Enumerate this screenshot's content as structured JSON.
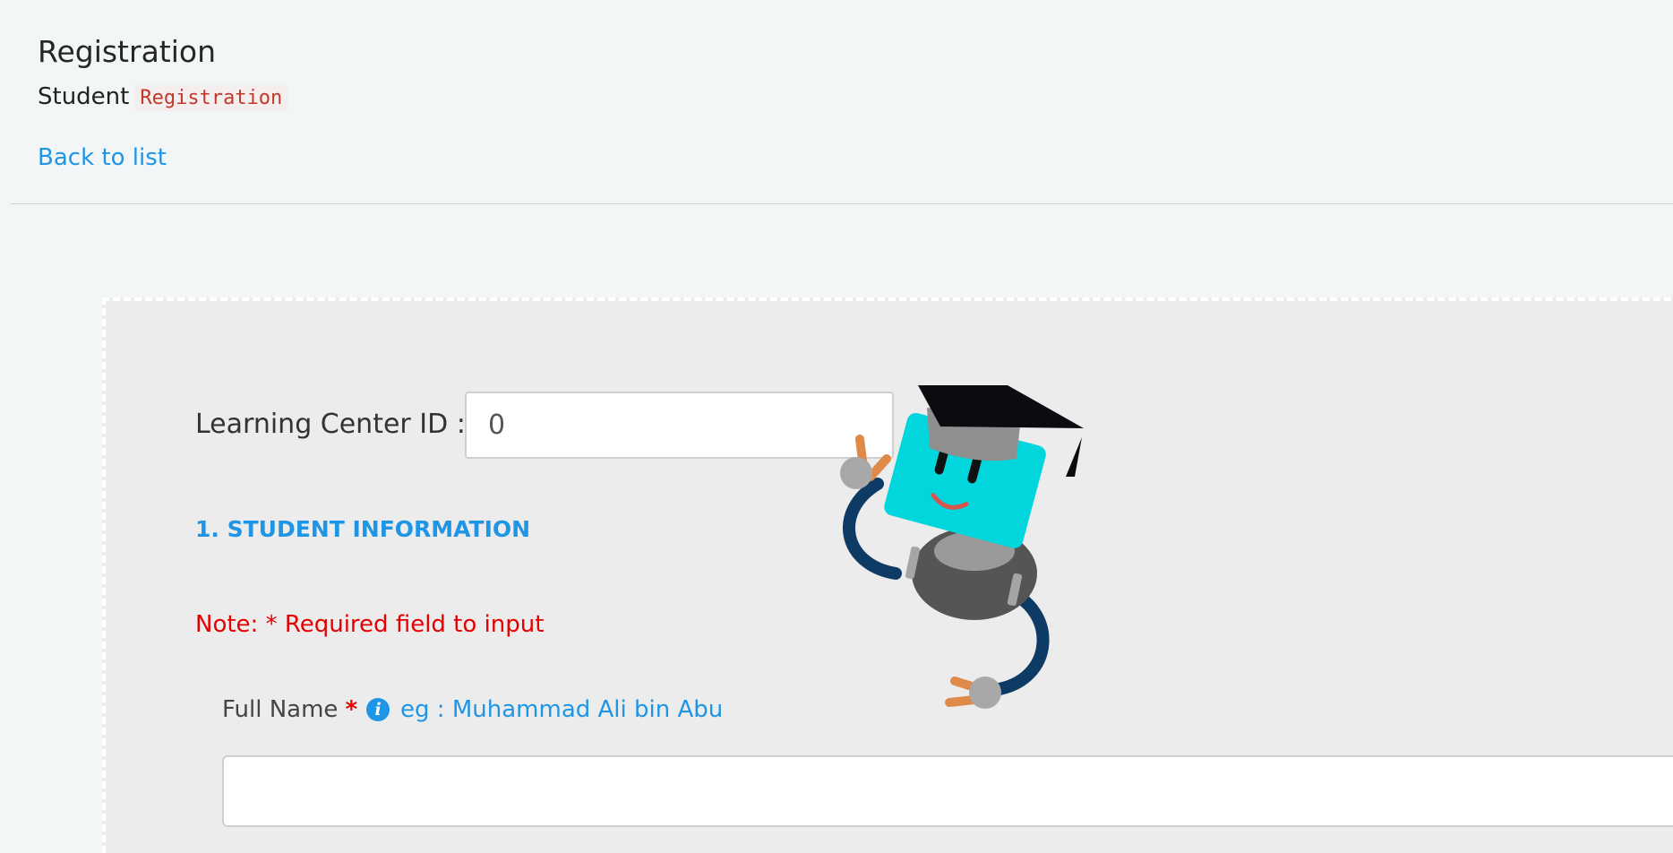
{
  "header": {
    "title": "Registration",
    "subtitle_prefix": "Student",
    "subtitle_code": "Registration",
    "back_link": "Back to list"
  },
  "form": {
    "learning_center": {
      "label": "Learning Center ID :",
      "value": "0"
    },
    "section_title": "1. STUDENT INFORMATION",
    "note": "Note: * Required field to input",
    "full_name": {
      "label": "Full Name",
      "required_mark": "*",
      "info_glyph": "i",
      "hint": "eg   : Muhammad Ali bin Abu",
      "value": ""
    }
  },
  "mascot": {
    "icon": "graduate-robot-icon"
  },
  "colors": {
    "accent": "#1f95e6",
    "required": "#e60000",
    "card_bg": "#ececec",
    "page_bg": "#f2f6f6"
  }
}
